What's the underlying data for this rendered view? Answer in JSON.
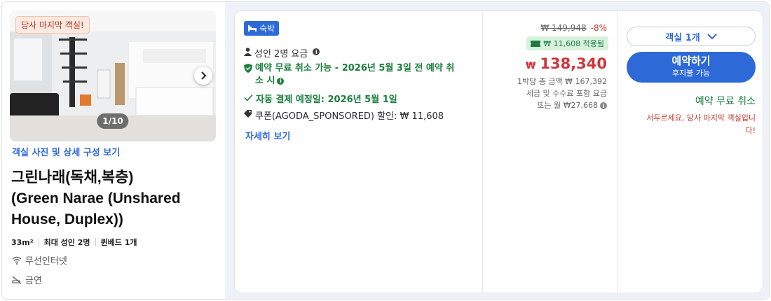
{
  "photo": {
    "badge": "당사 마지막 객실!",
    "counter": "1/10",
    "link": "객실 사진 및 상세 구성 보기"
  },
  "room": {
    "title_line1": "그린나래(독채,복층)",
    "title_line2": "(Green Narae (Unshared",
    "title_line3": "House, Duplex))",
    "size": "33m²",
    "max_guests": "최대 성인 2명",
    "bed": "퀸베드 1개",
    "amenities": [
      "무선인터넷",
      "금연"
    ]
  },
  "offer": {
    "tag": "숙박",
    "guests": "성인 2명 요금",
    "cancel_line1": "예약 무료 취소 가능 - 2026년 5월 3일 전 예약 취",
    "cancel_line2": "소 시",
    "autopay": "자동 결제 예정일: 2026년 5월 1일",
    "coupon": "쿠폰(AGODA_SPONSORED) 할인: ₩ 11,608",
    "detail_link": "자세히 보기"
  },
  "price": {
    "original": "₩ 149,948",
    "discount_pct": "-8%",
    "coupon_applied": "₩ 11,608 적용됨",
    "currency": "₩",
    "amount": "138,340",
    "note_line1": "1박당 총 금액 ₩ 167,392",
    "note_line2": "세금 및 수수료 포함 요금",
    "note_line3": "또는 월 ₩27,668"
  },
  "booking": {
    "room_count": "객실 1개",
    "book_label": "예약하기",
    "book_sub": "후지불 가능",
    "free_cancel": "예약 무료 취소",
    "hurry_line1": "서두르세요, 당사 마지막 객실입니",
    "hurry_line2": "다!"
  },
  "colors": {
    "accent": "#2d6ad8",
    "price_red": "#d0343a",
    "green": "#1a7f3c"
  }
}
